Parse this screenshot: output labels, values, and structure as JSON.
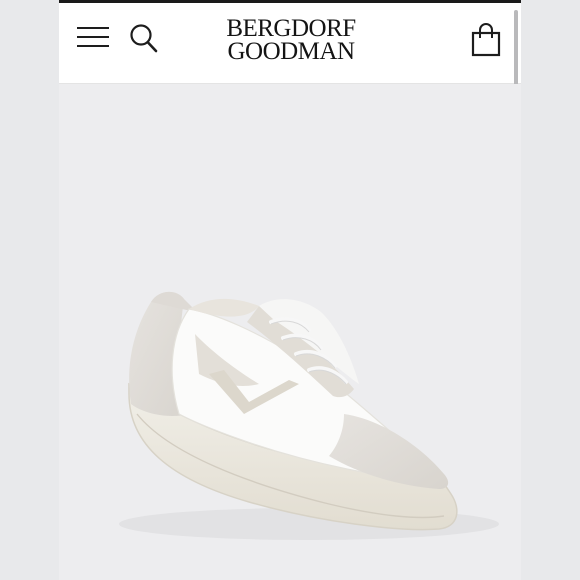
{
  "header": {
    "logo_line1": "BERGDORF",
    "logo_line2": "GOODMAN",
    "menu_icon": "hamburger-menu-icon",
    "search_icon": "search-icon",
    "bag_icon": "shopping-bag-icon"
  },
  "product": {
    "image": "white-leather-sneaker"
  },
  "colors": {
    "header_bg": "#ffffff",
    "page_bg": "#ededef",
    "ink": "#1a1a1a"
  }
}
